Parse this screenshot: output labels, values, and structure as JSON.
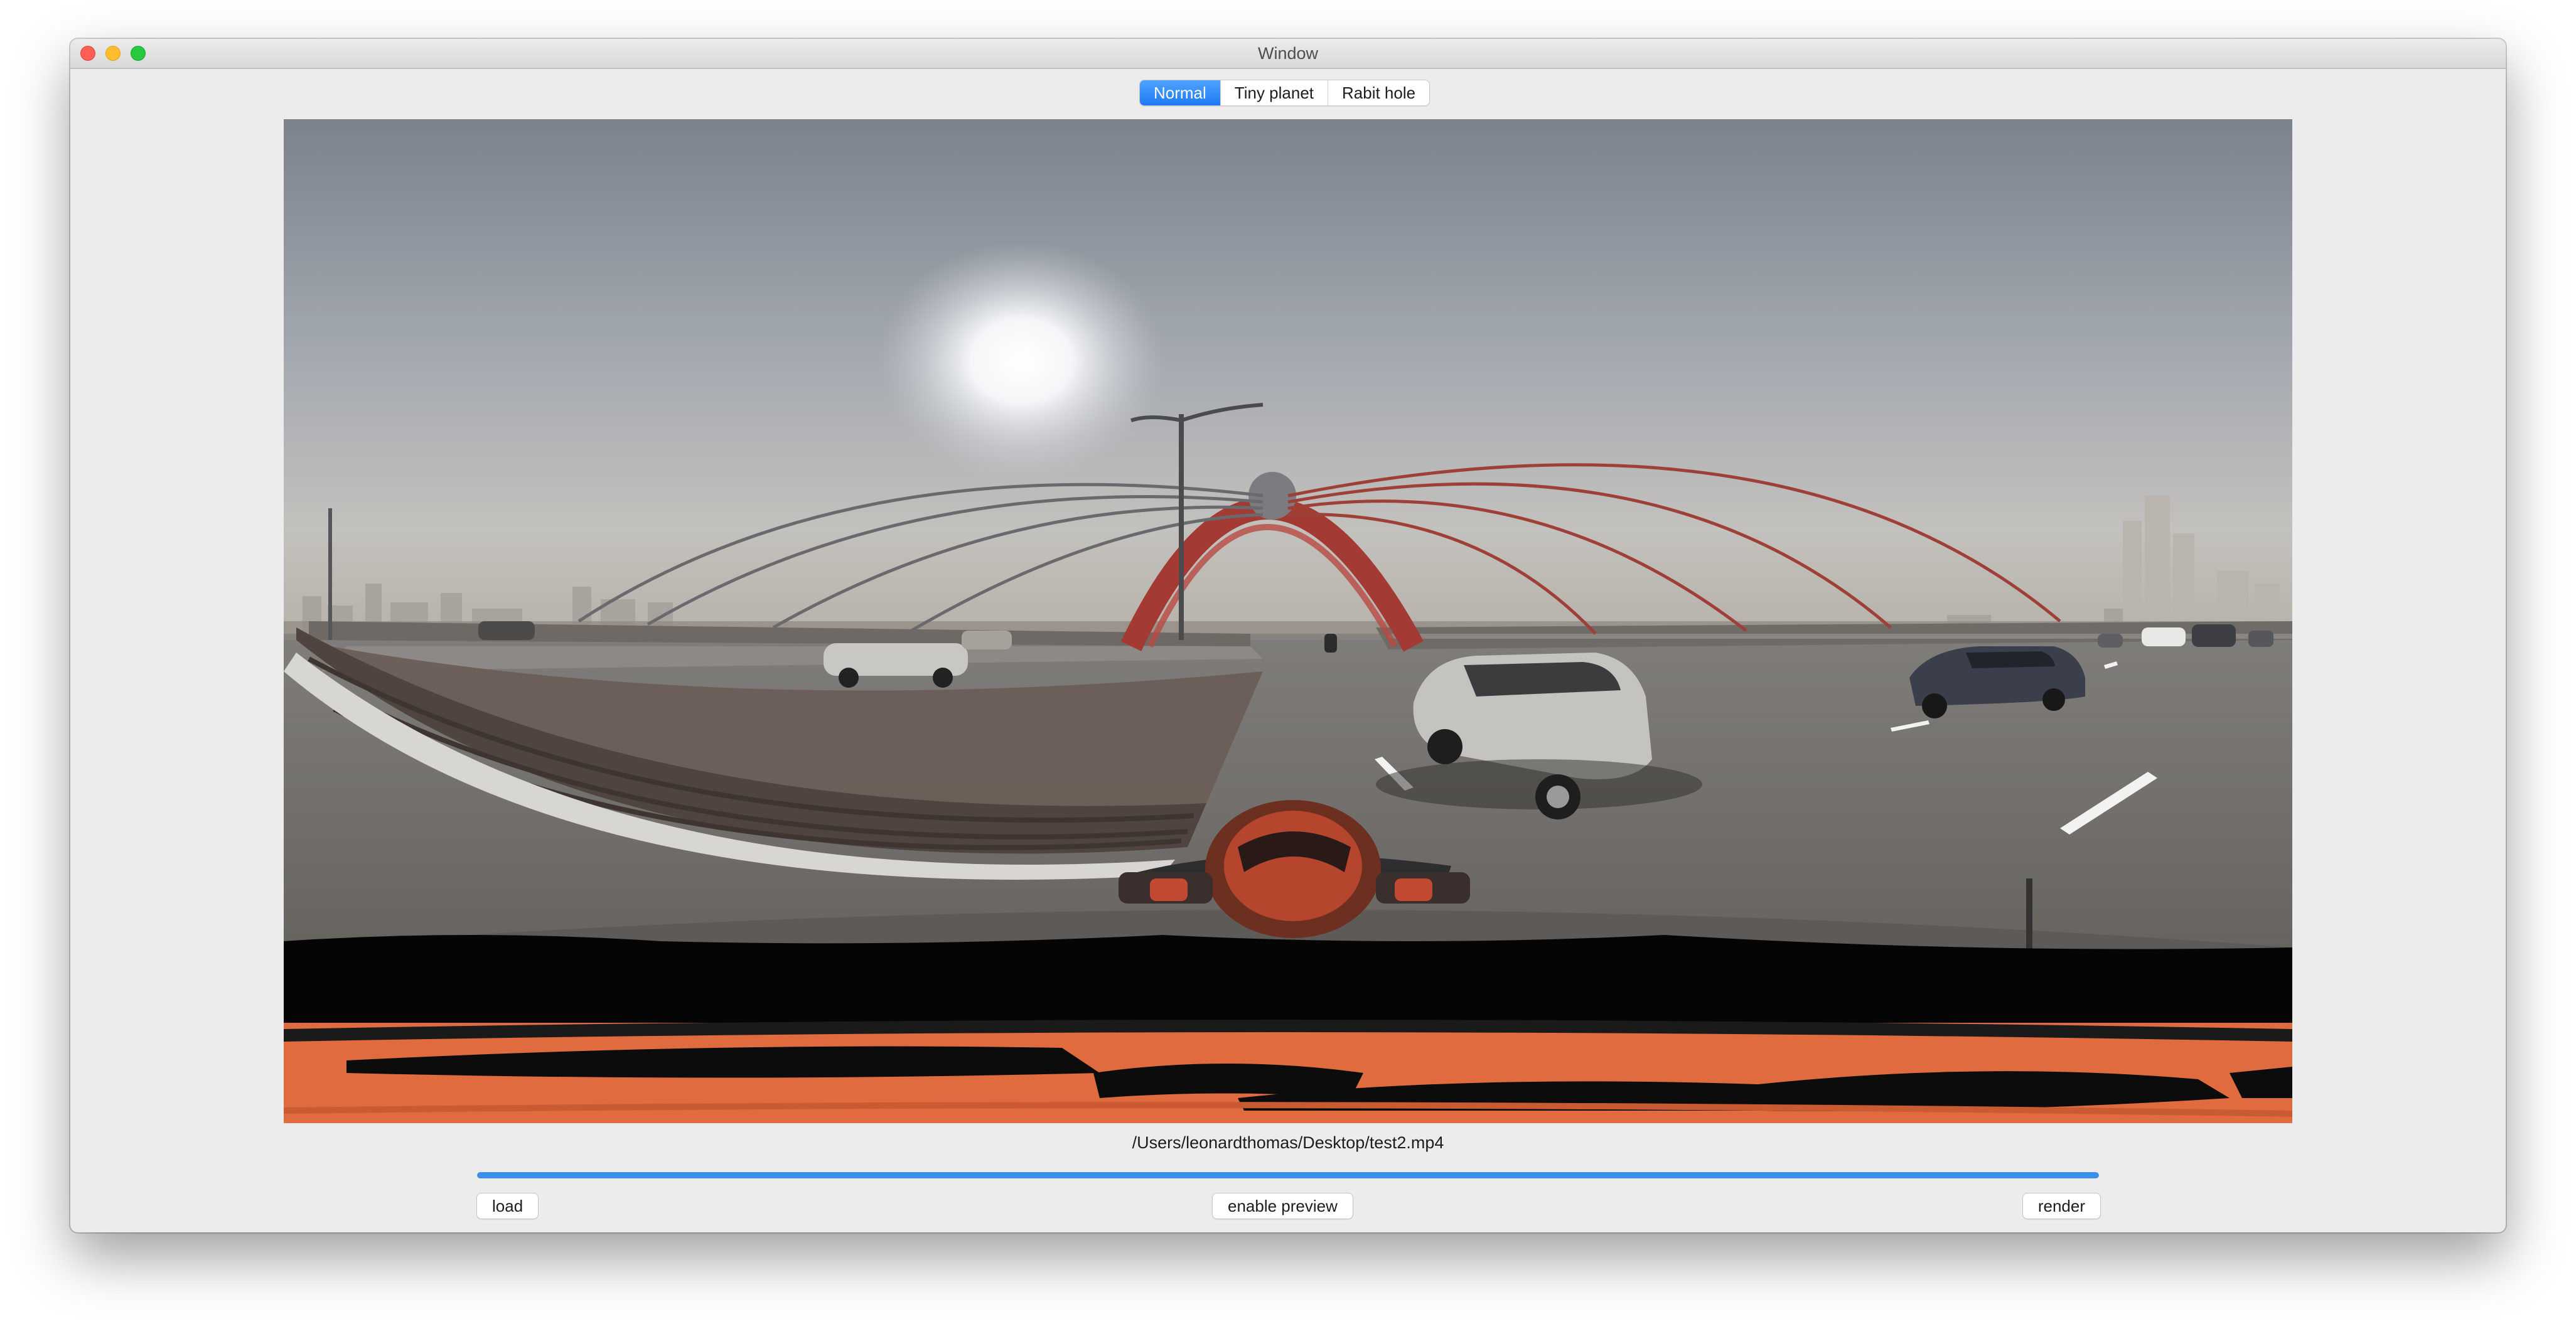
{
  "window": {
    "title": "Window"
  },
  "projection_modes": {
    "items": [
      {
        "label": "Normal",
        "selected": true
      },
      {
        "label": "Tiny planet",
        "selected": false
      },
      {
        "label": "Rabit hole",
        "selected": false
      }
    ]
  },
  "preview": {
    "content": "360-degree equirectangular video frame"
  },
  "file": {
    "path": "/Users/leonardthomas/Desktop/test2.mp4"
  },
  "progress": {
    "value": 1.0
  },
  "buttons": {
    "load_label": "load",
    "preview_label": "enable preview",
    "render_label": "render"
  },
  "colors": {
    "accent": "#3b8fe8",
    "close": "#fe5f57",
    "minimize": "#febc2e",
    "maximize": "#28c840",
    "window_bg": "#ececec"
  }
}
